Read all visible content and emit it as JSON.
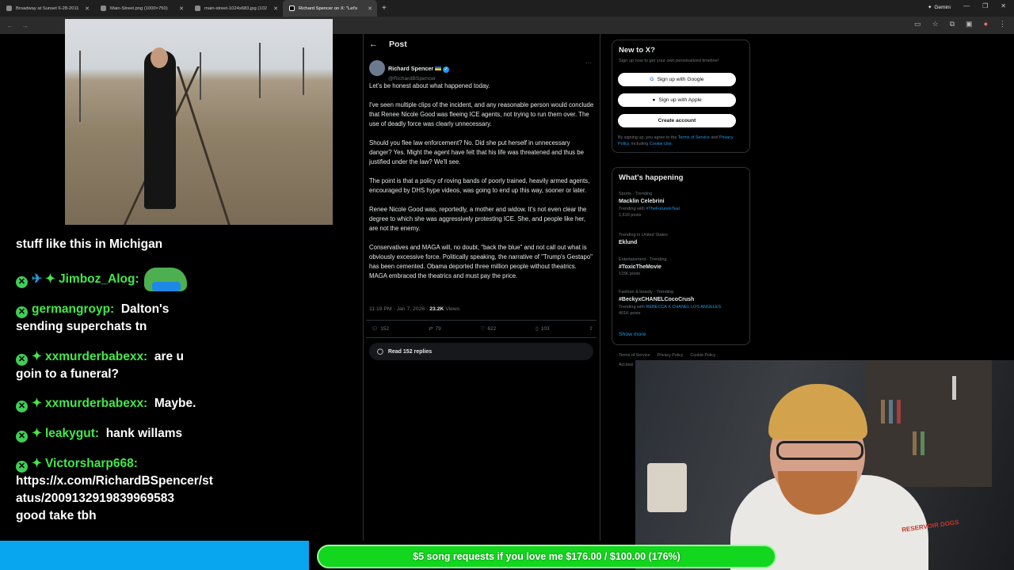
{
  "browser": {
    "tabs": [
      {
        "title": "Broadway at Sunset 6-28-2011",
        "active": false
      },
      {
        "title": "Main-Street.png (1000×750)",
        "active": false
      },
      {
        "title": "main-street-1024x683.jpg (102",
        "active": false
      },
      {
        "title": "Richard Spencer on X: \"Let's",
        "active": true
      }
    ],
    "gemini_label": "Gemini"
  },
  "chat": {
    "partial_line": "stuff like this in Michigan",
    "messages": [
      {
        "user": "Jimboz_Alog:",
        "text": ""
      },
      {
        "user": "germangroyp:",
        "text": "Dalton's",
        "text2": "sending superchats tn"
      },
      {
        "user": "xxmurderbabexx:",
        "text": "are u",
        "text2": "goin to a funeral?"
      },
      {
        "user": "xxmurderbabexx:",
        "text": "Maybe."
      },
      {
        "user": "leakygut:",
        "text": "hank willams"
      },
      {
        "user": "Victorsharp668:",
        "text": "https://x.com/RichardBSpencer/st",
        "text2": "atus/2009132919839969583",
        "text3": "good take tbh"
      }
    ]
  },
  "post": {
    "header": "Post",
    "author_name": "Richard Spencer",
    "author_handle": "@RichardBSpencer",
    "paragraphs": [
      "Let's be honest about what happened today.",
      "I've seen multiple clips of the incident, and any reasonable person would conclude that Renee Nicole Good was fleeing ICE agents, not trying to run them over. The use of deadly force was clearly unnecessary.",
      "Should you flee law enforcement? No. Did she put herself in unnecessary danger? Yes. Might the agent have felt that his life was threatened and thus be justified under the law? We'll see.",
      "The point is that a policy of roving bands of poorly trained, heavily armed agents, encouraged by DHS hype videos, was going to end up this way, sooner or later.",
      "Renee Nicole Good was, reportedly, a mother and widow. It's not even clear the degree to which she was aggressively protesting ICE. She, and people like her, are not the enemy.",
      "Conservatives and MAGA will, no doubt, \"back the blue\" and not call out what is obviously excessive force. Politically speaking, the narrative of \"Trump's Gestapo\" has been cemented. Obama deported three million people without theatrics. MAGA embraced the theatrics and must pay the price."
    ],
    "timestamp": "11:19 PM · Jan 7, 2026 · ",
    "views_count": "23.2K",
    "views_label": " Views",
    "replies": "152",
    "reposts": "79",
    "likes": "622",
    "bookmarks": "103",
    "read_replies": "Read 152 replies"
  },
  "sidebar": {
    "new_to_x": {
      "title": "New to X?",
      "subtitle": "Sign up now to get your own personalized timeline!",
      "google_btn": "Sign up with Google",
      "apple_btn": "Sign up with Apple",
      "create_btn": "Create account",
      "terms_prefix": "By signing up, you agree to the ",
      "terms_link": "Terms of Service",
      "terms_mid": " and ",
      "privacy_link": "Privacy Policy",
      "terms_mid2": ", including ",
      "cookie_link": "Cookie Use."
    },
    "happening": {
      "title": "What's happening",
      "trends": [
        {
          "category": "Sports · Trending",
          "topic": "Macklin Celebrini",
          "extra_prefix": "Trending with ",
          "extra_link": "#TheFuturelsTeal",
          "count": "1,616 posts"
        },
        {
          "category": "Trending in United States",
          "topic": "Eklund",
          "extra_prefix": "",
          "extra_link": "",
          "count": ""
        },
        {
          "category": "Entertainment · Trending",
          "topic": "#ToxicTheMovie",
          "extra_prefix": "",
          "extra_link": "",
          "count": "115K posts"
        },
        {
          "category": "Fashion & beauty · Trending",
          "topic": "#BeckyxCHANELCocoCrush",
          "extra_prefix": "Trending with ",
          "extra_link": "REBECCA X CHANEL LOS ANGELES",
          "count": "401K posts"
        }
      ],
      "show_more": "Show more"
    },
    "footer": [
      "Terms of Service",
      "Privacy Policy",
      "Cookie Policy"
    ],
    "footer2": "Accessi"
  },
  "overlay": {
    "goal_text": "$5 song requests if you love me $176.00 / $100.00 (176%)",
    "goal_progress": 1.76,
    "shirt_text": "RESERVOIR DOGS"
  }
}
